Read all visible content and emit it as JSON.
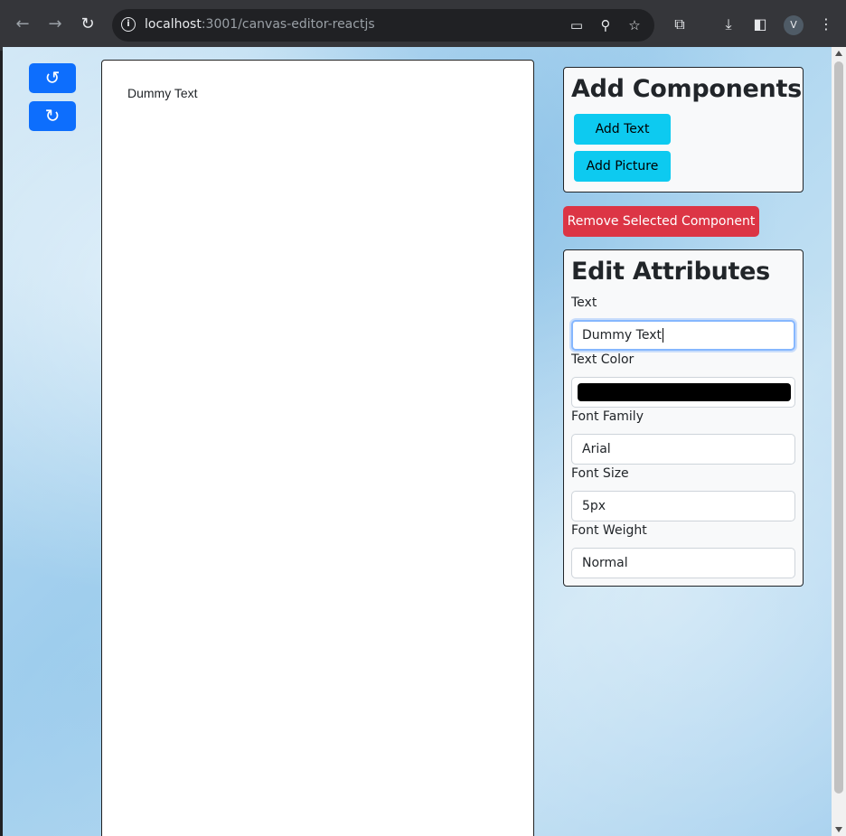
{
  "browser": {
    "url_host": "localhost",
    "url_path": ":3001/canvas-editor-reactjs",
    "profile_initial": "V"
  },
  "toolbar": {
    "undo_icon": "undo-icon",
    "redo_icon": "redo-icon"
  },
  "canvas": {
    "dummy_text": "Dummy Text"
  },
  "add_components": {
    "title": "Add Components",
    "add_text_label": "Add Text",
    "add_picture_label": "Add Picture"
  },
  "remove_button_label": "Remove Selected Component",
  "edit_attributes": {
    "title": "Edit Attributes",
    "text_label": "Text",
    "text_value": "Dummy Text",
    "text_color_label": "Text Color",
    "text_color_value": "#000000",
    "font_family_label": "Font Family",
    "font_family_value": "Arial",
    "font_size_label": "Font Size",
    "font_size_value": "5px",
    "font_weight_label": "Font Weight",
    "font_weight_value": "Normal"
  },
  "colors": {
    "primary": "#0d6efd",
    "info": "#0dcaf0",
    "danger": "#dc3545"
  }
}
